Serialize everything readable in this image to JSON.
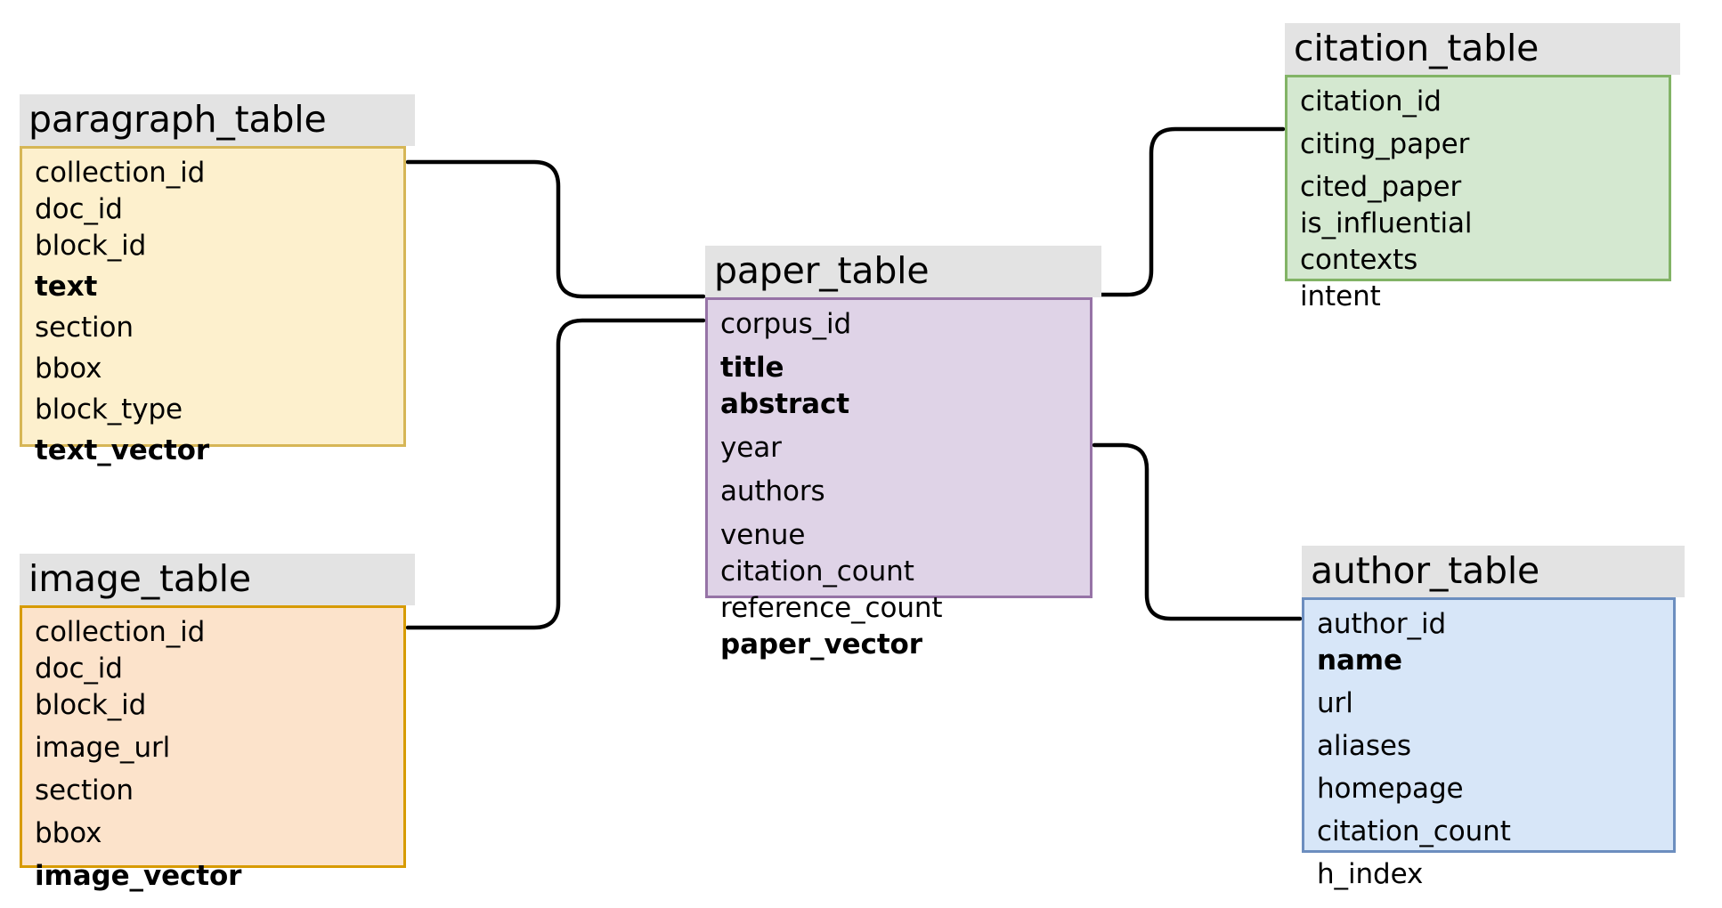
{
  "diagram": {
    "type": "entity-relationship-schema",
    "background_color": "#ffffff",
    "header_color": "#e3e3e3"
  },
  "tables": {
    "paragraph": {
      "title": "paragraph_table",
      "fill": "#fdf0cd",
      "border": "#d6b656",
      "fields": [
        "collection_id",
        "doc_id",
        "block_id",
        "text",
        "section",
        "bbox",
        "block_type",
        "text_vector"
      ]
    },
    "image": {
      "title": "image_table",
      "fill": "#fce3cb",
      "border": "#d79b00",
      "fields": [
        "collection_id",
        "doc_id",
        "block_id",
        "image_url",
        "section",
        "bbox",
        "image_vector"
      ]
    },
    "paper": {
      "title": "paper_table",
      "fill": "#dfd3e7",
      "border": "#9673a6",
      "fields": [
        "corpus_id",
        "title",
        "abstract",
        "year",
        "authors",
        "venue",
        "citation_count",
        "reference_count",
        "paper_vector"
      ]
    },
    "citation": {
      "title": "citation_table",
      "fill": "#d4e8d0",
      "border": "#82b366",
      "fields": [
        "citation_id",
        "citing_paper",
        "cited_paper",
        "is_influential",
        "contexts",
        "intent"
      ]
    },
    "author": {
      "title": "author_table",
      "fill": "#d7e6f8",
      "border": "#6c8ebf",
      "fields": [
        "author_id",
        "name",
        "url",
        "aliases",
        "homepage",
        "citation_count",
        "h_index"
      ]
    }
  },
  "relationships": [
    {
      "from": "paragraph_table",
      "to": "paper_table"
    },
    {
      "from": "image_table",
      "to": "paper_table"
    },
    {
      "from": "paper_table",
      "to": "citation_table"
    },
    {
      "from": "paper_table",
      "to": "author_table"
    }
  ]
}
